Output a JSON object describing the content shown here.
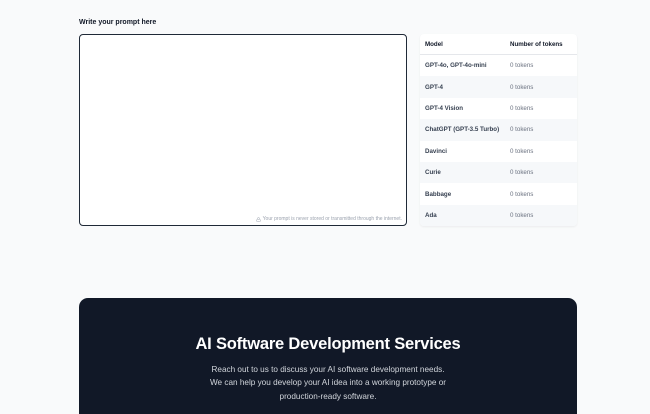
{
  "prompt": {
    "label": "Write your prompt here",
    "value": "",
    "privacy_note": "Your prompt is never stored or transmitted through the internet."
  },
  "token_table": {
    "headers": {
      "model": "Model",
      "tokens": "Number of tokens"
    },
    "rows": [
      {
        "model": "GPT-4o, GPT-4o-mini",
        "tokens": "0 tokens"
      },
      {
        "model": "GPT-4",
        "tokens": "0 tokens"
      },
      {
        "model": "GPT-4 Vision",
        "tokens": "0 tokens"
      },
      {
        "model": "ChatGPT (GPT-3.5 Turbo)",
        "tokens": "0 tokens"
      },
      {
        "model": "Davinci",
        "tokens": "0 tokens"
      },
      {
        "model": "Curie",
        "tokens": "0 tokens"
      },
      {
        "model": "Babbage",
        "tokens": "0 tokens"
      },
      {
        "model": "Ada",
        "tokens": "0 tokens"
      }
    ]
  },
  "services": {
    "title": "AI Software Development Services",
    "description_lines": [
      "Reach out to us to discuss your AI software development needs.",
      "We can help you develop your AI idea into a working prototype or",
      "production-ready software."
    ],
    "background_color": "#111827"
  },
  "icons": {
    "privacy": "lock-icon"
  }
}
